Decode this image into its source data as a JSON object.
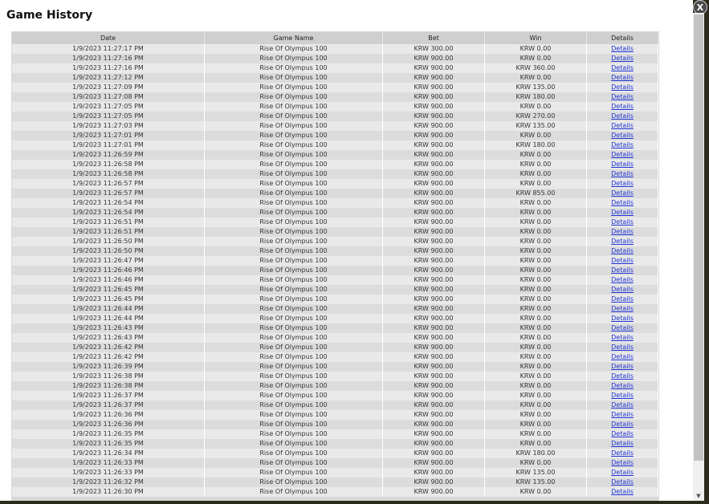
{
  "dialog": {
    "title": "Game History",
    "close_label": "X"
  },
  "table": {
    "headers": [
      "Date",
      "Game Name",
      "Bet",
      "Win",
      "Details"
    ],
    "rows": [
      [
        "1/9/2023 11:27:17 PM",
        "Rise Of Olympus 100",
        "KRW 300.00",
        "KRW 0.00",
        "Details"
      ],
      [
        "1/9/2023 11:27:16 PM",
        "Rise Of Olympus 100",
        "KRW 900.00",
        "KRW 0.00",
        "Details"
      ],
      [
        "1/9/2023 11:27:16 PM",
        "Rise Of Olympus 100",
        "KRW 900.00",
        "KRW 360.00",
        "Details"
      ],
      [
        "1/9/2023 11:27:12 PM",
        "Rise Of Olympus 100",
        "KRW 900.00",
        "KRW 0.00",
        "Details"
      ],
      [
        "1/9/2023 11:27:09 PM",
        "Rise Of Olympus 100",
        "KRW 900.00",
        "KRW 135.00",
        "Details"
      ],
      [
        "1/9/2023 11:27:08 PM",
        "Rise Of Olympus 100",
        "KRW 900.00",
        "KRW 180.00",
        "Details"
      ],
      [
        "1/9/2023 11:27:05 PM",
        "Rise Of Olympus 100",
        "KRW 900.00",
        "KRW 0.00",
        "Details"
      ],
      [
        "1/9/2023 11:27:05 PM",
        "Rise Of Olympus 100",
        "KRW 900.00",
        "KRW 270.00",
        "Details"
      ],
      [
        "1/9/2023 11:27:03 PM",
        "Rise Of Olympus 100",
        "KRW 900.00",
        "KRW 135.00",
        "Details"
      ],
      [
        "1/9/2023 11:27:01 PM",
        "Rise Of Olympus 100",
        "KRW 900.00",
        "KRW 0.00",
        "Details"
      ],
      [
        "1/9/2023 11:27:01 PM",
        "Rise Of Olympus 100",
        "KRW 900.00",
        "KRW 180.00",
        "Details"
      ],
      [
        "1/9/2023 11:26:59 PM",
        "Rise Of Olympus 100",
        "KRW 900.00",
        "KRW 0.00",
        "Details"
      ],
      [
        "1/9/2023 11:26:58 PM",
        "Rise Of Olympus 100",
        "KRW 900.00",
        "KRW 0.00",
        "Details"
      ],
      [
        "1/9/2023 11:26:58 PM",
        "Rise Of Olympus 100",
        "KRW 900.00",
        "KRW 0.00",
        "Details"
      ],
      [
        "1/9/2023 11:26:57 PM",
        "Rise Of Olympus 100",
        "KRW 900.00",
        "KRW 0.00",
        "Details"
      ],
      [
        "1/9/2023 11:26:57 PM",
        "Rise Of Olympus 100",
        "KRW 900.00",
        "KRW 855.00",
        "Details"
      ],
      [
        "1/9/2023 11:26:54 PM",
        "Rise Of Olympus 100",
        "KRW 900.00",
        "KRW 0.00",
        "Details"
      ],
      [
        "1/9/2023 11:26:54 PM",
        "Rise Of Olympus 100",
        "KRW 900.00",
        "KRW 0.00",
        "Details"
      ],
      [
        "1/9/2023 11:26:51 PM",
        "Rise Of Olympus 100",
        "KRW 900.00",
        "KRW 0.00",
        "Details"
      ],
      [
        "1/9/2023 11:26:51 PM",
        "Rise Of Olympus 100",
        "KRW 900.00",
        "KRW 0.00",
        "Details"
      ],
      [
        "1/9/2023 11:26:50 PM",
        "Rise Of Olympus 100",
        "KRW 900.00",
        "KRW 0.00",
        "Details"
      ],
      [
        "1/9/2023 11:26:50 PM",
        "Rise Of Olympus 100",
        "KRW 900.00",
        "KRW 0.00",
        "Details"
      ],
      [
        "1/9/2023 11:26:47 PM",
        "Rise Of Olympus 100",
        "KRW 900.00",
        "KRW 0.00",
        "Details"
      ],
      [
        "1/9/2023 11:26:46 PM",
        "Rise Of Olympus 100",
        "KRW 900.00",
        "KRW 0.00",
        "Details"
      ],
      [
        "1/9/2023 11:26:46 PM",
        "Rise Of Olympus 100",
        "KRW 900.00",
        "KRW 0.00",
        "Details"
      ],
      [
        "1/9/2023 11:26:45 PM",
        "Rise Of Olympus 100",
        "KRW 900.00",
        "KRW 0.00",
        "Details"
      ],
      [
        "1/9/2023 11:26:45 PM",
        "Rise Of Olympus 100",
        "KRW 900.00",
        "KRW 0.00",
        "Details"
      ],
      [
        "1/9/2023 11:26:44 PM",
        "Rise Of Olympus 100",
        "KRW 900.00",
        "KRW 0.00",
        "Details"
      ],
      [
        "1/9/2023 11:26:44 PM",
        "Rise Of Olympus 100",
        "KRW 900.00",
        "KRW 0.00",
        "Details"
      ],
      [
        "1/9/2023 11:26:43 PM",
        "Rise Of Olympus 100",
        "KRW 900.00",
        "KRW 0.00",
        "Details"
      ],
      [
        "1/9/2023 11:26:43 PM",
        "Rise Of Olympus 100",
        "KRW 900.00",
        "KRW 0.00",
        "Details"
      ],
      [
        "1/9/2023 11:26:42 PM",
        "Rise Of Olympus 100",
        "KRW 900.00",
        "KRW 0.00",
        "Details"
      ],
      [
        "1/9/2023 11:26:42 PM",
        "Rise Of Olympus 100",
        "KRW 900.00",
        "KRW 0.00",
        "Details"
      ],
      [
        "1/9/2023 11:26:39 PM",
        "Rise Of Olympus 100",
        "KRW 900.00",
        "KRW 0.00",
        "Details"
      ],
      [
        "1/9/2023 11:26:38 PM",
        "Rise Of Olympus 100",
        "KRW 900.00",
        "KRW 0.00",
        "Details"
      ],
      [
        "1/9/2023 11:26:38 PM",
        "Rise Of Olympus 100",
        "KRW 900.00",
        "KRW 0.00",
        "Details"
      ],
      [
        "1/9/2023 11:26:37 PM",
        "Rise Of Olympus 100",
        "KRW 900.00",
        "KRW 0.00",
        "Details"
      ],
      [
        "1/9/2023 11:26:37 PM",
        "Rise Of Olympus 100",
        "KRW 900.00",
        "KRW 0.00",
        "Details"
      ],
      [
        "1/9/2023 11:26:36 PM",
        "Rise Of Olympus 100",
        "KRW 900.00",
        "KRW 0.00",
        "Details"
      ],
      [
        "1/9/2023 11:26:36 PM",
        "Rise Of Olympus 100",
        "KRW 900.00",
        "KRW 0.00",
        "Details"
      ],
      [
        "1/9/2023 11:26:35 PM",
        "Rise Of Olympus 100",
        "KRW 900.00",
        "KRW 0.00",
        "Details"
      ],
      [
        "1/9/2023 11:26:35 PM",
        "Rise Of Olympus 100",
        "KRW 900.00",
        "KRW 0.00",
        "Details"
      ],
      [
        "1/9/2023 11:26:34 PM",
        "Rise Of Olympus 100",
        "KRW 900.00",
        "KRW 180.00",
        "Details"
      ],
      [
        "1/9/2023 11:26:33 PM",
        "Rise Of Olympus 100",
        "KRW 900.00",
        "KRW 0.00",
        "Details"
      ],
      [
        "1/9/2023 11:26:33 PM",
        "Rise Of Olympus 100",
        "KRW 900.00",
        "KRW 135.00",
        "Details"
      ],
      [
        "1/9/2023 11:26:32 PM",
        "Rise Of Olympus 100",
        "KRW 900.00",
        "KRW 135.00",
        "Details"
      ],
      [
        "1/9/2023 11:26:30 PM",
        "Rise Of Olympus 100",
        "KRW 900.00",
        "KRW 0.00",
        "Details"
      ]
    ]
  },
  "colors": {
    "link": "#1f33d6",
    "header_bg": "#cfcfcf",
    "row_odd": "#e9e9e9",
    "row_even": "#dcdcdc"
  },
  "icons": {
    "close": "close-icon",
    "scroll_down": "chevron-down-icon"
  }
}
